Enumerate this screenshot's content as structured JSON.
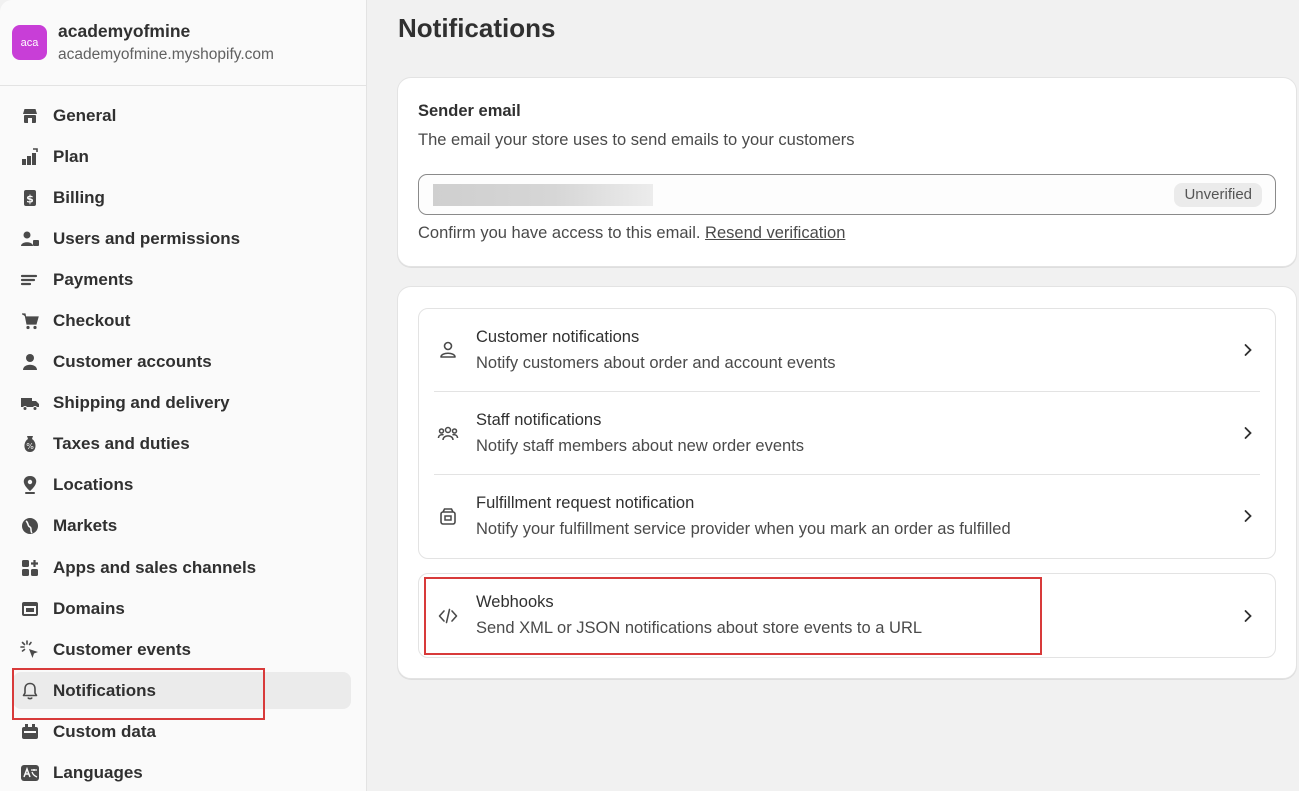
{
  "store": {
    "avatar_text": "aca",
    "name": "academyofmine",
    "url": "academyofmine.myshopify.com",
    "avatar_color": "#c83ed7"
  },
  "sidebar": {
    "items": [
      {
        "label": "General",
        "icon": "store-icon"
      },
      {
        "label": "Plan",
        "icon": "plan-icon"
      },
      {
        "label": "Billing",
        "icon": "billing-icon"
      },
      {
        "label": "Users and permissions",
        "icon": "users-icon"
      },
      {
        "label": "Payments",
        "icon": "payments-icon"
      },
      {
        "label": "Checkout",
        "icon": "cart-icon"
      },
      {
        "label": "Customer accounts",
        "icon": "person-icon"
      },
      {
        "label": "Shipping and delivery",
        "icon": "truck-icon"
      },
      {
        "label": "Taxes and duties",
        "icon": "tax-icon"
      },
      {
        "label": "Locations",
        "icon": "location-icon"
      },
      {
        "label": "Markets",
        "icon": "globe-icon"
      },
      {
        "label": "Apps and sales channels",
        "icon": "apps-icon"
      },
      {
        "label": "Domains",
        "icon": "domains-icon"
      },
      {
        "label": "Customer events",
        "icon": "cursor-click-icon"
      },
      {
        "label": "Notifications",
        "icon": "bell-icon",
        "active": true
      },
      {
        "label": "Custom data",
        "icon": "custom-data-icon"
      },
      {
        "label": "Languages",
        "icon": "language-icon"
      }
    ]
  },
  "main": {
    "title": "Notifications",
    "sender": {
      "title": "Sender email",
      "description": "The email your store uses to send emails to your customers",
      "status_badge": "Unverified",
      "confirm_text": "Confirm you have access to this email.",
      "resend_link": "Resend verification"
    },
    "rows": [
      {
        "title": "Customer notifications",
        "description": "Notify customers about order and account events",
        "icon": "person-outline-icon"
      },
      {
        "title": "Staff notifications",
        "description": "Notify staff members about new order events",
        "icon": "staff-icon"
      },
      {
        "title": "Fulfillment request notification",
        "description": "Notify your fulfillment service provider when you mark an order as fulfilled",
        "icon": "fulfillment-icon"
      }
    ],
    "webhooks": {
      "title": "Webhooks",
      "description": "Send XML or JSON notifications about store events to a URL",
      "icon": "code-icon"
    }
  },
  "colors": {
    "highlight": "#d83a3a",
    "background": "#f1f1f1"
  }
}
